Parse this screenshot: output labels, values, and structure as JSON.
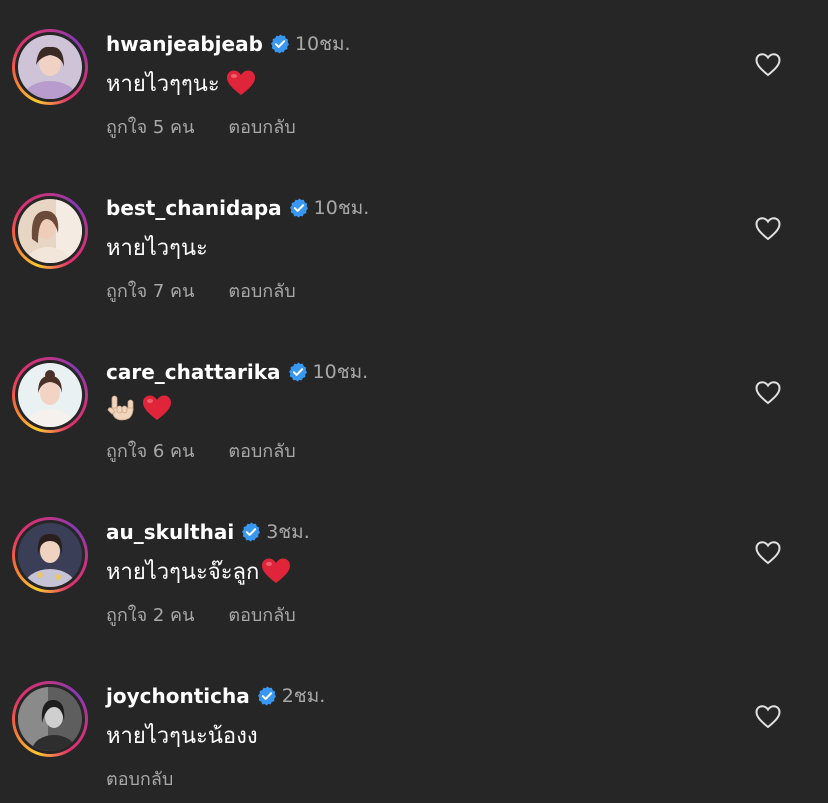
{
  "comments": [
    {
      "username": "hwanjeabjeab",
      "time": "10ชม.",
      "text": "หายไวๆๆนะ",
      "has_heart": true,
      "likes": "ถูกใจ 5 คน",
      "reply": "ตอบกลับ"
    },
    {
      "username": "best_chanidapa",
      "time": "10ชม.",
      "text": "หายไวๆนะ",
      "has_heart": false,
      "likes": "ถูกใจ 7 คน",
      "reply": "ตอบกลับ"
    },
    {
      "username": "care_chattarika",
      "time": "10ชม.",
      "text": "",
      "has_heart": true,
      "likes": "ถูกใจ 6 คน",
      "reply": "ตอบกลับ"
    },
    {
      "username": "au_skulthai",
      "time": "3ชม.",
      "text": "หายไวๆนะจ๊ะลูก",
      "has_heart": true,
      "likes": "ถูกใจ 2 คน",
      "reply": "ตอบกลับ"
    },
    {
      "username": "joychonticha",
      "time": "2ชม.",
      "text": "หายไวๆนะน้องง",
      "has_heart": false,
      "likes": "",
      "reply": "ตอบกลับ"
    }
  ],
  "icons": {
    "verified": "verified-badge-icon",
    "like": "heart-outline-icon",
    "heart_emoji": "red-heart-emoji",
    "hand_emoji": "love-you-gesture-emoji"
  },
  "colors": {
    "background": "#262626",
    "secondary_text": "#a8a8a8",
    "verified_blue": "#3897f0",
    "heart_red": "#e0253a"
  }
}
